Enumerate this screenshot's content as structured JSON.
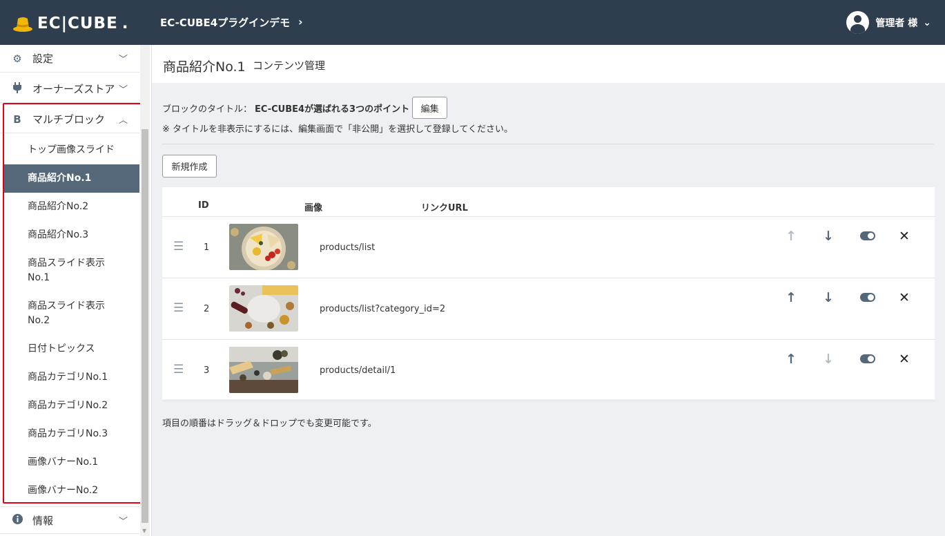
{
  "header": {
    "logo_text": "EC|CUBE",
    "shop_name": "EC-CUBE4プラグインデモ",
    "user_name": "管理者 様"
  },
  "sidebar": {
    "top_items": [
      {
        "label": "設定",
        "icon": "gear-icon"
      },
      {
        "label": "オーナーズストア",
        "icon": "plug-icon"
      }
    ],
    "group": {
      "label": "マルチブロック",
      "icon": "B",
      "items": [
        {
          "label": "トップ画像スライド"
        },
        {
          "label": "商品紹介No.1",
          "active": true
        },
        {
          "label": "商品紹介No.2"
        },
        {
          "label": "商品紹介No.3"
        },
        {
          "label": "商品スライド表示\nNo.1"
        },
        {
          "label": "商品スライド表示\nNo.2"
        },
        {
          "label": "日付トピックス"
        },
        {
          "label": "商品カテゴリNo.1"
        },
        {
          "label": "商品カテゴリNo.2"
        },
        {
          "label": "商品カテゴリNo.3"
        },
        {
          "label": "画像バナーNo.1"
        },
        {
          "label": "画像バナーNo.2"
        }
      ]
    },
    "bottom_items": [
      {
        "label": "情報",
        "icon": "info-icon"
      }
    ]
  },
  "main": {
    "title": "商品紹介No.1",
    "subtitle": "コンテンツ管理",
    "block_title_label": "ブロックのタイトル：",
    "block_title_value": "EC-CUBE4が選ばれる3つのポイント",
    "edit_button": "編集",
    "note": "※ タイトルを非表示にするには、編集画面で「非公開」を選択して登録してください。",
    "new_button": "新規作成",
    "table": {
      "headers": {
        "id": "ID",
        "image": "画像",
        "url": "リンクURL"
      },
      "rows": [
        {
          "id": "1",
          "url": "products/list",
          "up_disabled": true,
          "down_disabled": false
        },
        {
          "id": "2",
          "url": "products/list?category_id=2",
          "up_disabled": false,
          "down_disabled": false
        },
        {
          "id": "3",
          "url": "products/detail/1",
          "up_disabled": false,
          "down_disabled": true
        }
      ]
    },
    "footer_note": "項目の順番はドラッグ＆ドロップでも変更可能です。"
  },
  "colors": {
    "header_bg": "#2f3e4e",
    "active_bg": "#54687a",
    "highlight_box": "#e60012"
  }
}
